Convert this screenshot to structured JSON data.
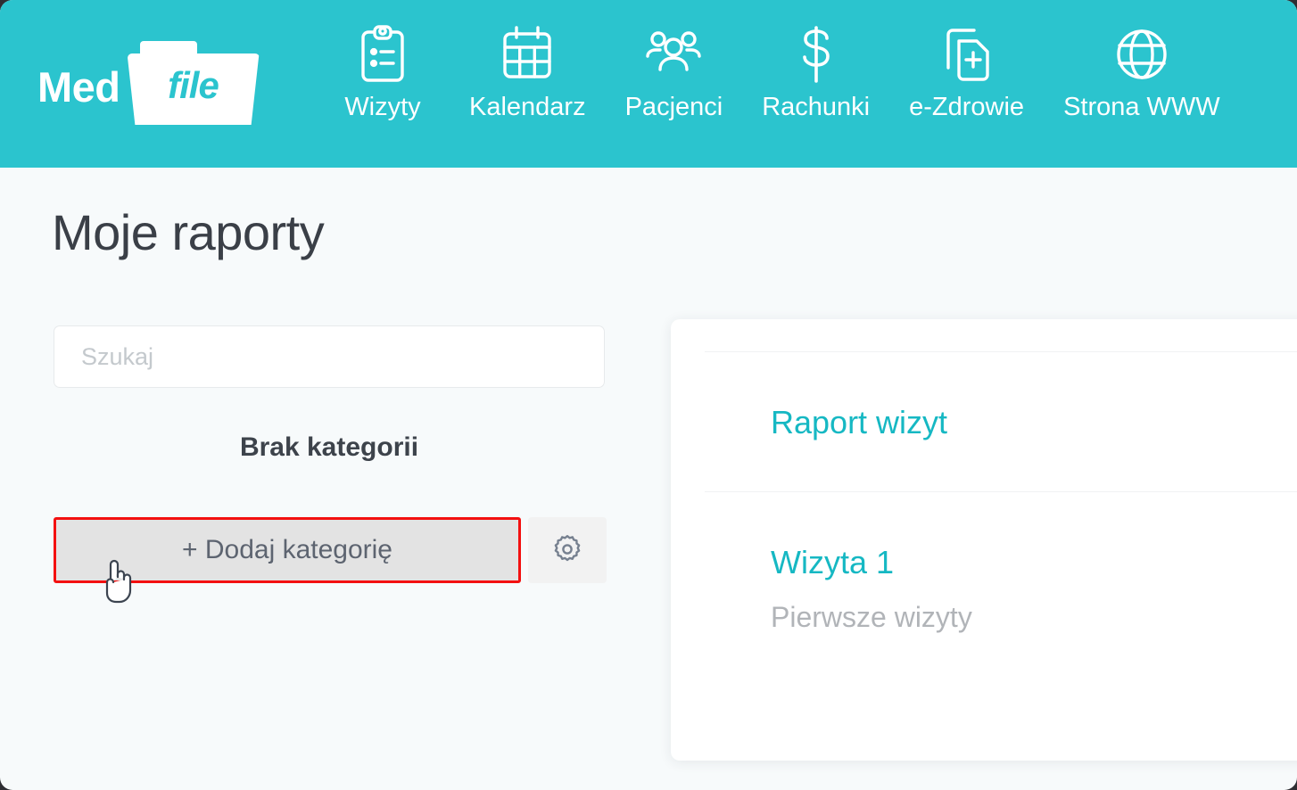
{
  "brand": {
    "word_med": "Med",
    "word_file": "file",
    "icon": "folder-icon"
  },
  "nav": {
    "items": [
      {
        "label": "Wizyty",
        "icon": "clipboard-icon"
      },
      {
        "label": "Kalendarz",
        "icon": "calendar-icon"
      },
      {
        "label": "Pacjenci",
        "icon": "people-group-icon"
      },
      {
        "label": "Rachunki",
        "icon": "dollar-sign-icon"
      },
      {
        "label": "e-Zdrowie",
        "icon": "medical-document-plus-icon"
      },
      {
        "label": "Strona WWW",
        "icon": "globe-icon"
      }
    ]
  },
  "page": {
    "title": "Moje raporty"
  },
  "sidebar": {
    "search_placeholder": "Szukaj",
    "search_value": "",
    "empty_state": "Brak kategorii",
    "add_category_label": "+ Dodaj kategorię",
    "settings_icon": "gear-icon",
    "cursor": "pointing-hand-cursor"
  },
  "panel": {
    "reports": [
      {
        "title": "Raport wizyt",
        "subtitle": ""
      },
      {
        "title": "Wizyta 1",
        "subtitle": "Pierwsze wizyty"
      }
    ]
  },
  "colors": {
    "header_teal": "#2bc4ce",
    "link_teal": "#16b8c3",
    "highlight_red": "#f31010",
    "page_bg": "#f7fafb",
    "button_gray": "#e3e3e3"
  }
}
